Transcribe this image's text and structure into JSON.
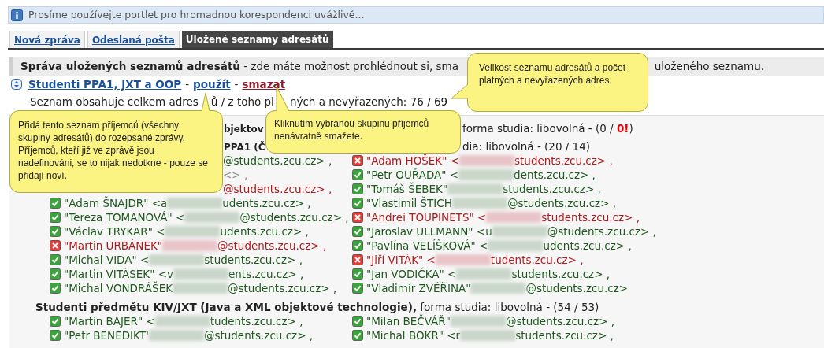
{
  "notice": {
    "text": "Prosíme používejte portlet pro hromadnou korespondenci uvážlivě..."
  },
  "tabs": [
    {
      "label": "Nová zpráva",
      "selected": false
    },
    {
      "label": "Odeslaná pošta",
      "selected": false
    },
    {
      "label": "Uložené seznamy adresátů",
      "selected": true
    }
  ],
  "header": {
    "text": "**Správa uložených seznamů adresátů** - zde máte možnost prohlédnout si, sma",
    "text_end": "uloženého seznamu."
  },
  "list": {
    "name": "Studenti PPA1, JXT a OOP",
    "separators": [
      "-",
      "-"
    ],
    "use_link": "použít",
    "delete_link": "smazat",
    "summary": [
      "Seznam obsahuje celkem adres",
      "ů / z toho pl",
      "ných a nevyřazených: 76 / 69"
    ]
  },
  "groups": [
    {
      "heading": "**bjektov**",
      "heading_end": "forma studia: libovolná - (0 / **0!**)"
    },
    {
      "heading": "**PPA1 (Č**",
      "heading_end": "dia: libovolná - (20 / 14)",
      "rows": [
        {
          "left": {
            "kind": "fragment",
            "valid": true,
            "after": "@students.zcu.cz> ,"
          },
          "right": {
            "kind": "entry",
            "valid": false,
            "before": "\"Adam HOŠEK\" <",
            "after": "students.zcu.cz> ,"
          }
        },
        {
          "left": {
            "kind": "fragment",
            "after": "<> ,"
          },
          "right": {
            "kind": "entry",
            "valid": true,
            "before": "\"Petr OUŘADA\" <",
            "after": "dents.zcu.cz> ,"
          }
        },
        {
          "left": {
            "kind": "fragment",
            "valid": false,
            "after": "@students.zcu.cz> ,"
          },
          "right": {
            "kind": "entry",
            "valid": true,
            "before": "\"Tomáš ŠEBEK\"",
            "after": "students.zcu.cz> ,"
          }
        },
        {
          "left": {
            "kind": "entry",
            "valid": true,
            "before": "\"Adam ŠNAJDR\" <a",
            "after": "udents.zcu.cz> ,"
          },
          "right": {
            "kind": "entry",
            "valid": true,
            "before": "\"Vlastimil ŠTICH",
            "after": "@students.zcu.cz> ,"
          }
        },
        {
          "left": {
            "kind": "entry",
            "valid": true,
            "before": "\"Tereza TOMANOVÁ\" <",
            "after": "@students.zcu.cz> ,"
          },
          "right": {
            "kind": "entry",
            "valid": false,
            "before": "\"Andrei TOUPINETS\" <",
            "after": "students.zcu.cz> ,"
          }
        },
        {
          "left": {
            "kind": "entry",
            "valid": true,
            "before": "\"Václav TRYKAR\" <",
            "after": "udents.zcu.cz> ,"
          },
          "right": {
            "kind": "entry",
            "valid": true,
            "before": "\"Jaroslav ULLMANN\" <u",
            "after": "@students.zcu.cz> ,"
          }
        },
        {
          "left": {
            "kind": "entry",
            "valid": false,
            "before": "\"Martin URBÁNEK\"",
            "after": "@students.zcu.cz> ,"
          },
          "right": {
            "kind": "entry",
            "valid": true,
            "before": "\"Pavlína VELÍŠKOVÁ\" <",
            "after": "udents.zcu.cz> ,"
          }
        },
        {
          "left": {
            "kind": "entry",
            "valid": true,
            "before": "\"Michal VIDA\" <",
            "after": "students.zcu.cz> ,"
          },
          "right": {
            "kind": "entry",
            "valid": false,
            "before": "\"Jiří VITÁK\" <",
            "after": "tudents.zcu.cz> ,"
          }
        },
        {
          "left": {
            "kind": "entry",
            "valid": true,
            "before": "\"Martin VITÁSEK\" <v",
            "after": "ents.zcu.cz> ,"
          },
          "right": {
            "kind": "entry",
            "valid": true,
            "before": "\"Jan VODIČKA\" <",
            "after": "students.zcu.cz> ,"
          }
        },
        {
          "left": {
            "kind": "entry",
            "valid": true,
            "before": "\"Michal VONDRÁŠEK",
            "after": "@students.zcu.cz> ,"
          },
          "right": {
            "kind": "entry",
            "valid": true,
            "before": "\"Vladimír ZVĚŘINA\"",
            "after": "@students.zcu.cz>"
          }
        }
      ]
    },
    {
      "heading": "**Studenti předmětu KIV/JXT (Java a XML objektové technologie),**  forma studia: libovolná - (54 / 53)",
      "rows": [
        {
          "left": {
            "kind": "entry",
            "valid": true,
            "before": "\"Martin BAJER\" <",
            "after": "tudents.zcu.cz> ,"
          },
          "right": {
            "kind": "entry",
            "valid": true,
            "before": "\"Milan BEČVÁŘ\"",
            "after": "@students.zcu.cz> ,"
          }
        },
        {
          "left": {
            "kind": "entry",
            "valid": true,
            "before": "\"Petr BENEDIKT'",
            "after": "@students.zcu.cz> ,"
          },
          "right": {
            "kind": "entry",
            "valid": true,
            "before": "\"Michal BOKR\" <r",
            "after": "students.zcu.cz> ,"
          }
        }
      ]
    }
  ],
  "tooltips": [
    {
      "kind": "size",
      "text": "Velikost seznamu adresátů a počet platných a nevyřazených adres"
    },
    {
      "kind": "use",
      "text": "Přidá tento seznam příjemců (všechny skupiny adresátů) do rozepsané zprávy. Příjemců, kteří již ve zprávě jsou nadefinováni, se to nijak nedotkne - pouze se přidají noví."
    },
    {
      "kind": "delete",
      "text": "Kliknutím vybranou skupinu příjemců nenávratně smažete."
    }
  ]
}
